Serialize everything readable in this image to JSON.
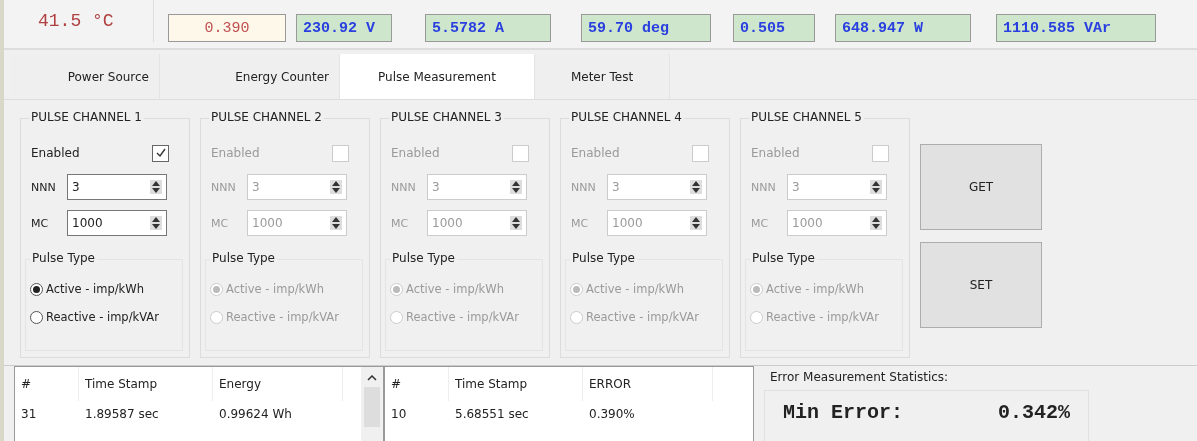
{
  "temperature": "41.5 °C",
  "readouts": [
    {
      "kind": "error",
      "value": "0.390"
    },
    {
      "kind": "measured",
      "value": "230.92 V"
    },
    {
      "kind": "measured",
      "value": "5.5782 A"
    },
    {
      "kind": "measured",
      "value": "59.70 deg"
    },
    {
      "kind": "measured",
      "value": "0.505"
    },
    {
      "kind": "measured",
      "value": "648.947 W"
    },
    {
      "kind": "measured",
      "value": "1110.585 VAr"
    }
  ],
  "tabs": [
    {
      "label": "Power Source",
      "selected": false
    },
    {
      "label": "Energy Counter",
      "selected": false
    },
    {
      "label": "Pulse Measurement",
      "selected": true
    },
    {
      "label": "Meter Test",
      "selected": false
    }
  ],
  "channels": [
    {
      "title": "PULSE CHANNEL 1",
      "enabled_label": "Enabled",
      "enabled": true,
      "nnn_label": "NNN",
      "nnn": "3",
      "mc_label": "MC",
      "mc": "1000",
      "pulse_type_label": "Pulse Type",
      "options": [
        {
          "label": "Active - imp/kWh",
          "selected": true
        },
        {
          "label": "Reactive - imp/kVAr",
          "selected": false
        }
      ]
    },
    {
      "title": "PULSE CHANNEL 2",
      "enabled_label": "Enabled",
      "enabled": false,
      "nnn_label": "NNN",
      "nnn": "3",
      "mc_label": "MC",
      "mc": "1000",
      "pulse_type_label": "Pulse Type",
      "options": [
        {
          "label": "Active - imp/kWh",
          "selected": true
        },
        {
          "label": "Reactive - imp/kVAr",
          "selected": false
        }
      ]
    },
    {
      "title": "PULSE CHANNEL 3",
      "enabled_label": "Enabled",
      "enabled": false,
      "nnn_label": "NNN",
      "nnn": "3",
      "mc_label": "MC",
      "mc": "1000",
      "pulse_type_label": "Pulse Type",
      "options": [
        {
          "label": "Active - imp/kWh",
          "selected": true
        },
        {
          "label": "Reactive - imp/kVAr",
          "selected": false
        }
      ]
    },
    {
      "title": "PULSE CHANNEL 4",
      "enabled_label": "Enabled",
      "enabled": false,
      "nnn_label": "NNN",
      "nnn": "3",
      "mc_label": "MC",
      "mc": "1000",
      "pulse_type_label": "Pulse Type",
      "options": [
        {
          "label": "Active - imp/kWh",
          "selected": true
        },
        {
          "label": "Reactive - imp/kVAr",
          "selected": false
        }
      ]
    },
    {
      "title": "PULSE CHANNEL 5",
      "enabled_label": "Enabled",
      "enabled": false,
      "nnn_label": "NNN",
      "nnn": "3",
      "mc_label": "MC",
      "mc": "1000",
      "pulse_type_label": "Pulse Type",
      "options": [
        {
          "label": "Active - imp/kWh",
          "selected": true
        },
        {
          "label": "Reactive - imp/kVAr",
          "selected": false
        }
      ]
    }
  ],
  "buttons": [
    "GET",
    "SET"
  ],
  "energy_table": {
    "columns": [
      "#",
      "Time Stamp",
      "Energy"
    ],
    "rows": [
      [
        "31",
        "1.89587 sec",
        "0.99624 Wh"
      ]
    ]
  },
  "error_table": {
    "columns": [
      "#",
      "Time Stamp",
      "ERROR"
    ],
    "rows": [
      [
        "10",
        "5.68551 sec",
        "0.390%"
      ]
    ]
  },
  "statistics": {
    "title": "Error Measurement Statistics:",
    "label": "Min Error:",
    "value": "0.342%"
  }
}
